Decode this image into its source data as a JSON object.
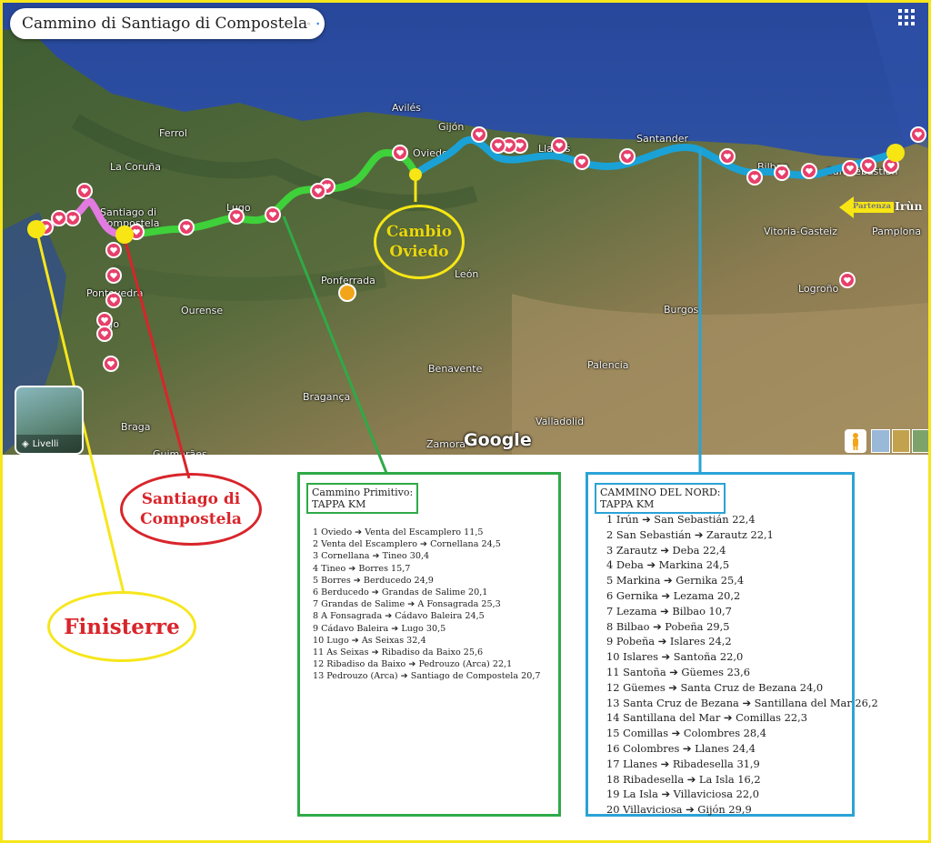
{
  "search": {
    "query": "Cammino di Santiago di Compostela"
  },
  "map": {
    "places": [
      "Ferrol",
      "La Coruña",
      "Santiago di Compostela",
      "Pontevedra",
      "Vigo",
      "Lugo",
      "Ourense",
      "Braga",
      "Guimarães",
      "Bragança",
      "Avilés",
      "Gijón",
      "Oviedo",
      "Llanes",
      "Santander",
      "Bilbao",
      "San Sebastián",
      "Vitoria-Gasteiz",
      "Pamplona",
      "Logroño",
      "Ponferrada",
      "León",
      "Burgos",
      "Palencia",
      "Benavente",
      "Valladolid",
      "Zamora"
    ],
    "layers_label": "Livelli",
    "attribution": "Google",
    "colors": {
      "nord": "#1aa2d6",
      "primitivo": "#3fd13a",
      "finisterre": "#e27ae0",
      "start_dot": "#f7e614",
      "marker": "#e7406a"
    }
  },
  "callouts": {
    "oviedo": [
      "Cambio",
      "Oviedo"
    ],
    "santiago": [
      "Santiago di",
      "Compostela"
    ],
    "finisterre": "Finisterre",
    "partenza_prefix": "Partenza",
    "partenza_city": "Irùn"
  },
  "primitivo": {
    "title": "Cammino Primitivo:",
    "subtitle": "TAPPA KM",
    "stages": [
      "1 Oviedo ➔ Venta del Escamplero 11,5",
      "2 Venta del Escamplero ➔ Cornellana 24,5",
      "3 Cornellana ➔ Tineo 30,4",
      "4 Tineo ➔ Borres 15,7",
      "5 Borres ➔ Berducedo 24,9",
      "6 Berducedo ➔ Grandas de Salime 20,1",
      "7 Grandas de Salime ➔ A Fonsagrada 25,3",
      "8 A Fonsagrada ➔ Cádavo Baleira 24,5",
      "9 Cádavo Baleira ➔ Lugo 30,5",
      "10 Lugo ➔ As Seixas 32,4",
      "11 As Seixas ➔ Ribadiso da Baixo 25,6",
      "12 Ribadiso da Baixo ➔ Pedrouzo (Arca) 22,1",
      "13 Pedrouzo (Arca) ➔ Santiago de Compostela 20,7"
    ]
  },
  "nord": {
    "title": "CAMMINO DEL NORD:",
    "subtitle": "TAPPA KM",
    "stages": [
      "1 Irún ➔ San Sebastián 22,4",
      "2 San Sebastián ➔ Zarautz 22,1",
      "3 Zarautz ➔ Deba 22,4",
      "4 Deba ➔ Markina 24,5",
      "5 Markina ➔ Gernika 25,4",
      "6 Gernika ➔ Lezama 20,2",
      "7 Lezama ➔ Bilbao 10,7",
      "8 Bilbao ➔ Pobeña 29,5",
      "9 Pobeña ➔ Islares 24,2",
      "10 Islares ➔ Santoña 22,0",
      "11 Santoña ➔ Güemes 23,6",
      "12 Güemes ➔ Santa Cruz de Bezana 24,0",
      "13 Santa Cruz de Bezana ➔ Santillana del Mar 26,2",
      "14 Santillana del Mar ➔ Comillas 22,3",
      "15 Comillas ➔ Colombres 28,4",
      "16 Colombres ➔ Llanes 24,4",
      "17 Llanes ➔ Ribadesella 31,9",
      "18 Ribadesella ➔ La Isla 16,2",
      "19 La Isla ➔ Villaviciosa 22,0",
      "20 Villaviciosa ➔ Gijón 29,9"
    ]
  }
}
